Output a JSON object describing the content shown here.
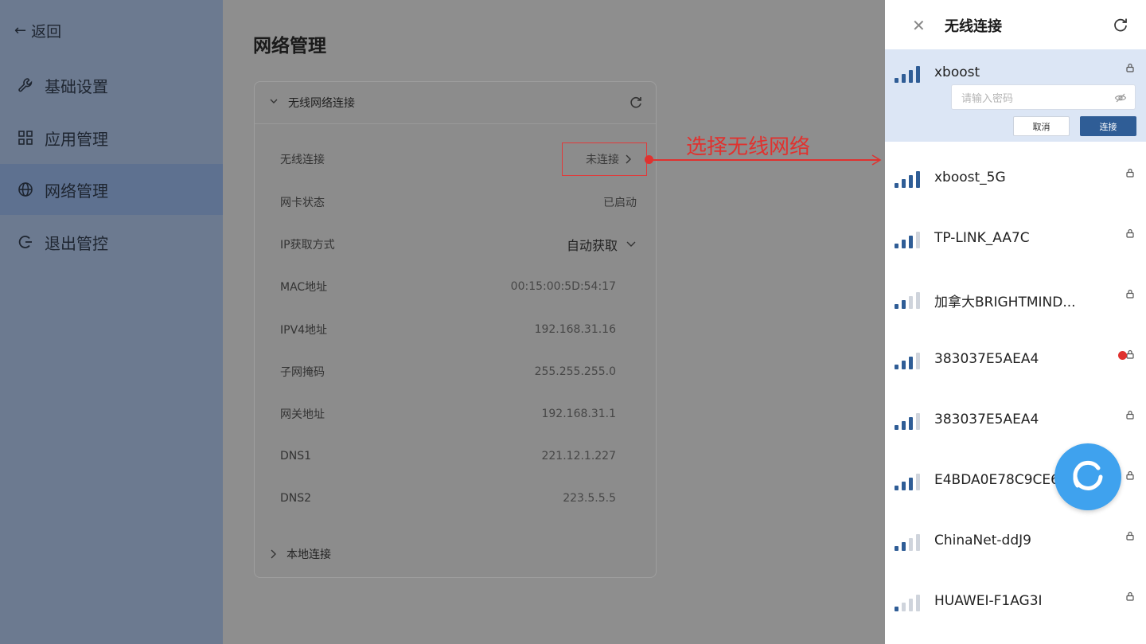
{
  "sidebar": {
    "back_label": "返回",
    "items": [
      {
        "label": "基础设置",
        "icon": "wrench-icon",
        "active": false
      },
      {
        "label": "应用管理",
        "icon": "grid-icon",
        "active": false
      },
      {
        "label": "网络管理",
        "icon": "globe-icon",
        "active": true
      },
      {
        "label": "退出管控",
        "icon": "logout-icon",
        "active": false
      }
    ]
  },
  "main": {
    "title": "网络管理",
    "wireless_section": {
      "header": "无线网络连接",
      "wireless_connection": {
        "label": "无线连接",
        "value": "未连接"
      },
      "nic_status": {
        "label": "网卡状态",
        "value": "已启动"
      },
      "ip_mode": {
        "label": "IP获取方式",
        "value": "自动获取"
      },
      "mac": {
        "label": "MAC地址",
        "value": "00:15:00:5D:54:17"
      },
      "ipv4": {
        "label": "IPV4地址",
        "value": "192.168.31.16"
      },
      "subnet": {
        "label": "子网掩码",
        "value": "255.255.255.0"
      },
      "gateway": {
        "label": "网关地址",
        "value": "192.168.31.1"
      },
      "dns1": {
        "label": "DNS1",
        "value": "221.12.1.227"
      },
      "dns2": {
        "label": "DNS2",
        "value": "223.5.5.5"
      }
    },
    "local_section": {
      "header": "本地连接"
    }
  },
  "annotation": {
    "text": "选择无线网络",
    "color": "#e0322f"
  },
  "wifi_panel": {
    "title": "无线连接",
    "password_placeholder": "请输入密码",
    "cancel_label": "取消",
    "connect_label": "连接",
    "networks": [
      {
        "name": "xboost",
        "signal": 4,
        "secured": true
      },
      {
        "name": "xboost_5G",
        "signal": 4,
        "secured": true
      },
      {
        "name": "TP-LINK_AA7C",
        "signal": 3,
        "secured": true
      },
      {
        "name": "加拿大BRIGHTMIND...",
        "signal": 2,
        "secured": true
      },
      {
        "name": "383037E5AEA4",
        "signal": 3,
        "secured": true
      },
      {
        "name": "383037E5AEA4",
        "signal": 3,
        "secured": true
      },
      {
        "name": "E4BDA0E78C9CE68...",
        "signal": 3,
        "secured": true
      },
      {
        "name": "ChinaNet-ddJ9",
        "signal": 2,
        "secured": true
      },
      {
        "name": "HUAWEI-F1AG3I",
        "signal": 1,
        "secured": true
      }
    ]
  },
  "colors": {
    "accent": "#2f5d96",
    "signal_active": "#2f5d96",
    "signal_inactive": "#cfd4dc"
  }
}
